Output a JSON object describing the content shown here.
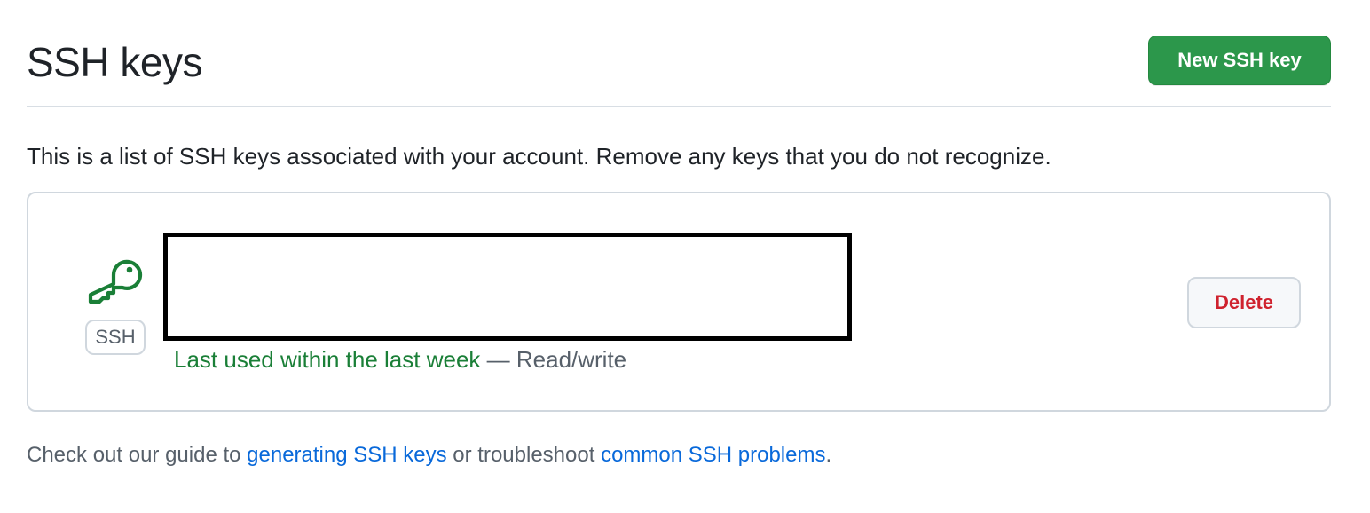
{
  "header": {
    "title": "SSH keys",
    "new_key_button": "New SSH key"
  },
  "description": "This is a list of SSH keys associated with your account. Remove any keys that you do not recognize.",
  "keys": [
    {
      "icon": "key-icon",
      "type_badge": "SSH",
      "last_used": "Last used within the last week",
      "access": " — Read/write",
      "delete_button": "Delete"
    }
  ],
  "footer": {
    "prefix": "Check out our guide to ",
    "link_generating": "generating SSH keys",
    "middle": " or troubleshoot ",
    "link_problems": "common SSH problems",
    "suffix": "."
  },
  "colors": {
    "primary_button": "#2c974b",
    "success_text": "#1a7f37",
    "danger_text": "#cf222e",
    "link": "#0969da",
    "muted_text": "#57606a",
    "border": "#d0d7de"
  }
}
